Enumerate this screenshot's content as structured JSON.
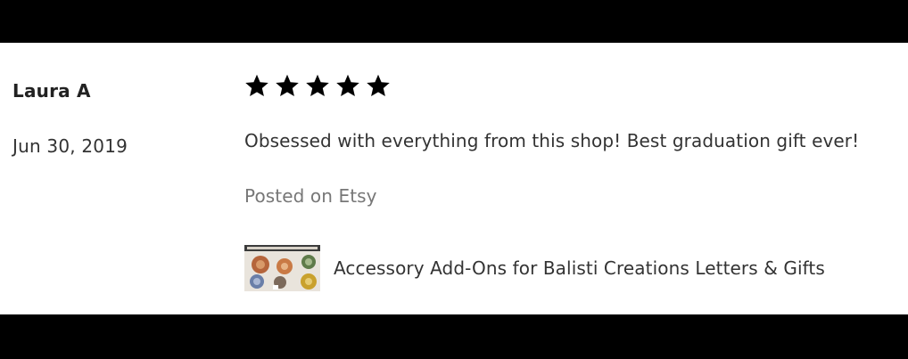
{
  "review": {
    "reviewer_name": "Laura A",
    "date": "Jun 30, 2019",
    "rating": 5,
    "max_rating": 5,
    "text": "Obsessed with everything from this shop! Best graduation gift ever!",
    "source": "Posted on Etsy",
    "product": {
      "title": "Accessory Add-Ons for Balisti Creations Letters & Gifts",
      "thumbnail_icon": "product-thumbnail-image"
    }
  },
  "colors": {
    "background": "#000000",
    "card": "#ffffff",
    "text_primary": "#222222",
    "text_muted": "#777777",
    "star": "#000000"
  }
}
